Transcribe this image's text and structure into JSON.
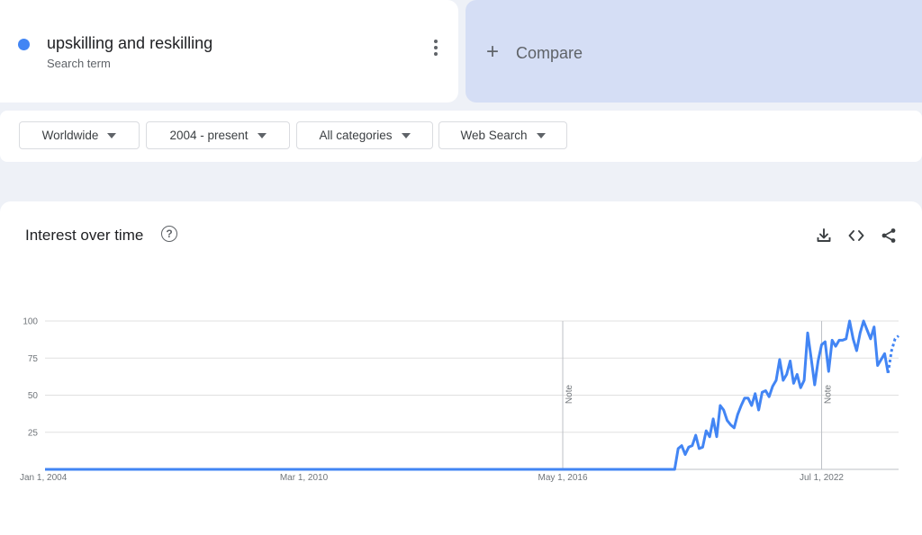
{
  "search_term": {
    "name": "upskilling and reskilling",
    "subtitle": "Search term",
    "color": "#4285f4"
  },
  "compare": {
    "label": "Compare"
  },
  "filters": {
    "geo": "Worldwide",
    "time": "2004 - present",
    "category": "All categories",
    "property": "Web Search"
  },
  "chart": {
    "title": "Interest over time",
    "icons": [
      "help-icon",
      "download-icon",
      "embed-icon",
      "share-icon"
    ]
  },
  "chart_data": {
    "type": "line",
    "title": "",
    "xlabel": "",
    "ylabel": "",
    "ylim": [
      0,
      100
    ],
    "yticks": [
      25,
      50,
      75,
      100
    ],
    "xticks": [
      "Jan 1, 2004",
      "Mar 1, 2010",
      "May 1, 2016",
      "Jul 1, 2022"
    ],
    "x_start": "2004-01",
    "x_end": "2024-05",
    "notes": [
      {
        "date": "2016-05",
        "label": "Note"
      },
      {
        "date": "2022-07",
        "label": "Note"
      }
    ],
    "series": [
      {
        "name": "upskilling and reskilling",
        "color": "#4285f4",
        "points": [
          [
            "2004-01",
            0
          ],
          [
            "2019-01",
            0
          ],
          [
            "2019-02",
            14
          ],
          [
            "2019-03",
            16
          ],
          [
            "2019-04",
            10
          ],
          [
            "2019-05",
            15
          ],
          [
            "2019-06",
            16
          ],
          [
            "2019-07",
            23
          ],
          [
            "2019-08",
            14
          ],
          [
            "2019-09",
            15
          ],
          [
            "2019-10",
            26
          ],
          [
            "2019-11",
            22
          ],
          [
            "2019-12",
            34
          ],
          [
            "2020-01",
            22
          ],
          [
            "2020-02",
            43
          ],
          [
            "2020-03",
            40
          ],
          [
            "2020-04",
            33
          ],
          [
            "2020-05",
            30
          ],
          [
            "2020-06",
            28
          ],
          [
            "2020-07",
            37
          ],
          [
            "2020-08",
            43
          ],
          [
            "2020-09",
            48
          ],
          [
            "2020-10",
            48
          ],
          [
            "2020-11",
            43
          ],
          [
            "2020-12",
            51
          ],
          [
            "2021-01",
            40
          ],
          [
            "2021-02",
            52
          ],
          [
            "2021-03",
            53
          ],
          [
            "2021-04",
            49
          ],
          [
            "2021-05",
            56
          ],
          [
            "2021-06",
            60
          ],
          [
            "2021-07",
            74
          ],
          [
            "2021-08",
            60
          ],
          [
            "2021-09",
            64
          ],
          [
            "2021-10",
            73
          ],
          [
            "2021-11",
            58
          ],
          [
            "2021-12",
            64
          ],
          [
            "2022-01",
            55
          ],
          [
            "2022-02",
            60
          ],
          [
            "2022-03",
            92
          ],
          [
            "2022-04",
            75
          ],
          [
            "2022-05",
            57
          ],
          [
            "2022-06",
            73
          ],
          [
            "2022-07",
            84
          ],
          [
            "2022-08",
            86
          ],
          [
            "2022-09",
            66
          ],
          [
            "2022-10",
            87
          ],
          [
            "2022-11",
            83
          ],
          [
            "2022-12",
            87
          ],
          [
            "2023-01",
            87
          ],
          [
            "2023-02",
            88
          ],
          [
            "2023-03",
            100
          ],
          [
            "2023-04",
            88
          ],
          [
            "2023-05",
            80
          ],
          [
            "2023-06",
            92
          ],
          [
            "2023-07",
            100
          ],
          [
            "2023-08",
            94
          ],
          [
            "2023-09",
            88
          ],
          [
            "2023-10",
            96
          ],
          [
            "2023-11",
            70
          ],
          [
            "2023-12",
            74
          ],
          [
            "2024-01",
            78
          ],
          [
            "2024-02",
            65
          ]
        ],
        "partial": [
          [
            "2024-02",
            65
          ],
          [
            "2024-03",
            80
          ],
          [
            "2024-04",
            88
          ],
          [
            "2024-05",
            90
          ]
        ]
      }
    ]
  }
}
